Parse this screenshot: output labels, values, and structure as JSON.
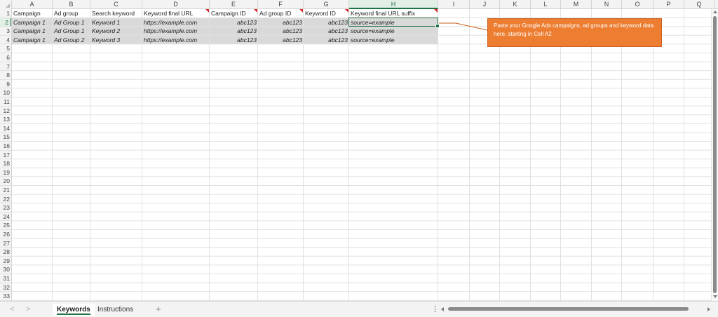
{
  "columns": [
    "A",
    "B",
    "C",
    "D",
    "E",
    "F",
    "G",
    "H",
    "I",
    "J",
    "K",
    "L",
    "M",
    "N",
    "O",
    "P",
    "Q"
  ],
  "selected_column": "H",
  "selected_row": "2",
  "row_count": 33,
  "header_row": [
    "Campaign",
    "Ad group",
    "Search keyword",
    "Keyword final URL",
    "Campaign ID",
    "Ad group ID",
    "Keyword ID",
    "Keyword final URL suffix"
  ],
  "data_rows": [
    [
      "Campaign 1",
      "Ad Group 1",
      "Keyword 1",
      "https://example.com",
      "abc123",
      "abc123",
      "abc123",
      "source=example"
    ],
    [
      "Campaign 1",
      "Ad Group 1",
      "Keyword 2",
      "https://example.com",
      "abc123",
      "abc123",
      "abc123",
      "source=example"
    ],
    [
      "Campaign 1",
      "Ad Group 2",
      "Keyword 3",
      "https://example.com",
      "abc123",
      "abc123",
      "abc123",
      "source=example"
    ]
  ],
  "callout": {
    "text": "Paste your Google Ads campaigns, ad groups and keyword data here, starting in Cell A2",
    "color": "#ed7d31"
  },
  "sheet_tabs": [
    {
      "label": "Keywords",
      "active": true
    },
    {
      "label": "Instructions",
      "active": false
    }
  ],
  "add_sheet_label": "+",
  "tab_nav": {
    "prev": "<",
    "next": ">",
    "more": "⋮"
  },
  "colors": {
    "accent": "#217346",
    "shade": "#d9d9d9",
    "comment_marker": "#d62b2b"
  }
}
